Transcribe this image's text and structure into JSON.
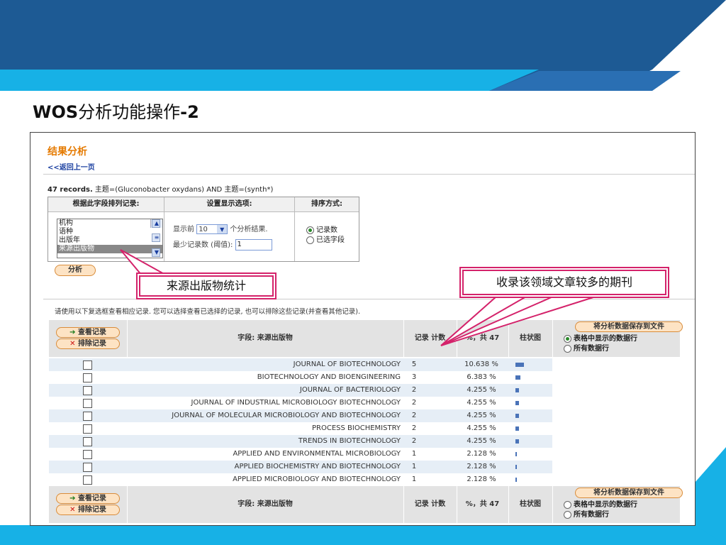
{
  "slide_title": {
    "prefix": "WOS",
    "rest": "分析功能操作",
    "suffix": "-2"
  },
  "panel": {
    "title": "结果分析",
    "back_link": "<<返回上一页",
    "records_bold": "47 records.",
    "records_query": " 主题=(Gluconobacter oxydans) AND 主题=(synth*)",
    "options": {
      "col1_header": "根据此字段排列记录:",
      "col2_header": "设置显示选项:",
      "col3_header": "排序方式:",
      "fields": [
        "机构",
        "语种",
        "出版年",
        "来源出版物"
      ],
      "selected_field": "来源出版物",
      "show_prefix": "显示前",
      "show_value": "10",
      "show_suffix": "个分析结果.",
      "min_label": "最少记录数 (阈值):",
      "min_value": "1",
      "sort_records": "记录数",
      "sort_field": "已选字段"
    },
    "analyze_button": "分析",
    "instruction": "请使用以下复选框查看相应记录. 您可以选择查看已选择的记录, 也可以排除这些记录(并查看其他记录).",
    "view_records": "查看记录",
    "exclude_records": "排除记录",
    "header_field": "字段: 来源出版物",
    "header_count": "记录 计数",
    "header_pct": "%，共 47",
    "header_bar": "柱状图",
    "save_button": "将分析数据保存到文件",
    "save_opt_shown": "表格中显示的数据行",
    "save_opt_all": "所有数据行",
    "rows": [
      {
        "name": "JOURNAL OF BIOTECHNOLOGY",
        "count": "5",
        "pct": "10.638 %",
        "bar": 10.638
      },
      {
        "name": "BIOTECHNOLOGY AND BIOENGINEERING",
        "count": "3",
        "pct": "6.383 %",
        "bar": 6.383
      },
      {
        "name": "JOURNAL OF BACTERIOLOGY",
        "count": "2",
        "pct": "4.255 %",
        "bar": 4.255
      },
      {
        "name": "JOURNAL OF INDUSTRIAL MICROBIOLOGY BIOTECHNOLOGY",
        "count": "2",
        "pct": "4.255 %",
        "bar": 4.255
      },
      {
        "name": "JOURNAL OF MOLECULAR MICROBIOLOGY AND BIOTECHNOLOGY",
        "count": "2",
        "pct": "4.255 %",
        "bar": 4.255
      },
      {
        "name": "PROCESS BIOCHEMISTRY",
        "count": "2",
        "pct": "4.255 %",
        "bar": 4.255
      },
      {
        "name": "TRENDS IN BIOTECHNOLOGY",
        "count": "2",
        "pct": "4.255 %",
        "bar": 4.255
      },
      {
        "name": "APPLIED AND ENVIRONMENTAL MICROBIOLOGY",
        "count": "1",
        "pct": "2.128 %",
        "bar": 2.128
      },
      {
        "name": "APPLIED BIOCHEMISTRY AND BIOTECHNOLOGY",
        "count": "1",
        "pct": "2.128 %",
        "bar": 2.128
      },
      {
        "name": "APPLIED MICROBIOLOGY AND BIOTECHNOLOGY",
        "count": "1",
        "pct": "2.128 %",
        "bar": 2.128
      }
    ]
  },
  "callouts": {
    "left": "来源出版物统计",
    "right": "收录该领域文章较多的期刊"
  },
  "colors": {
    "header_dark": "#1d5a94",
    "header_cyan": "#17b1e6",
    "accent_orange": "#e57a00",
    "callout_border": "#d4226a",
    "bar": "#4a73b8"
  }
}
